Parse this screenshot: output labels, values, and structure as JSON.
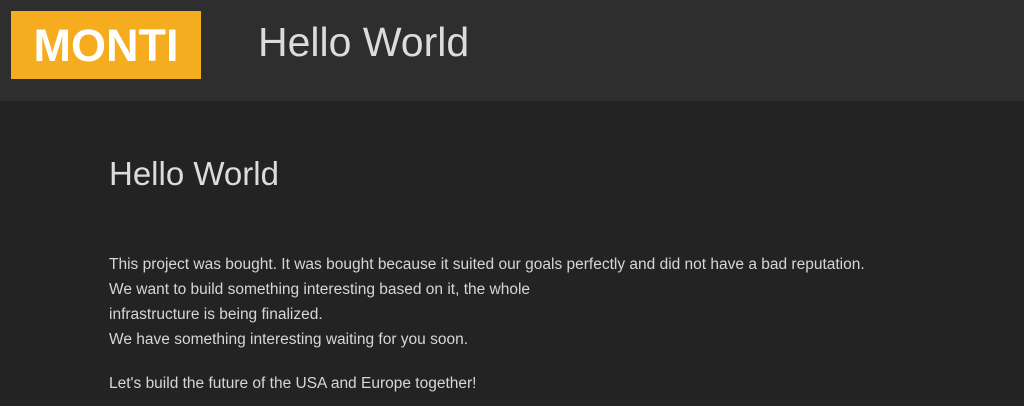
{
  "header": {
    "logo_text": "MONTI",
    "site_title": "Hello World"
  },
  "colors": {
    "logo_background": "#f5ad1f",
    "header_background": "#2e2e2e",
    "page_background": "#232323",
    "text": "#dcdcdc"
  },
  "main": {
    "heading": "Hello World",
    "paragraph_lines": [
      "This project was bought. It was bought because it suited our goals perfectly and did not have a bad reputation.",
      "We want to build something interesting based on it, the whole",
      "infrastructure is being finalized.",
      "We have something interesting waiting for you soon."
    ],
    "closing": "Let's build the future of the USA and Europe together!"
  }
}
